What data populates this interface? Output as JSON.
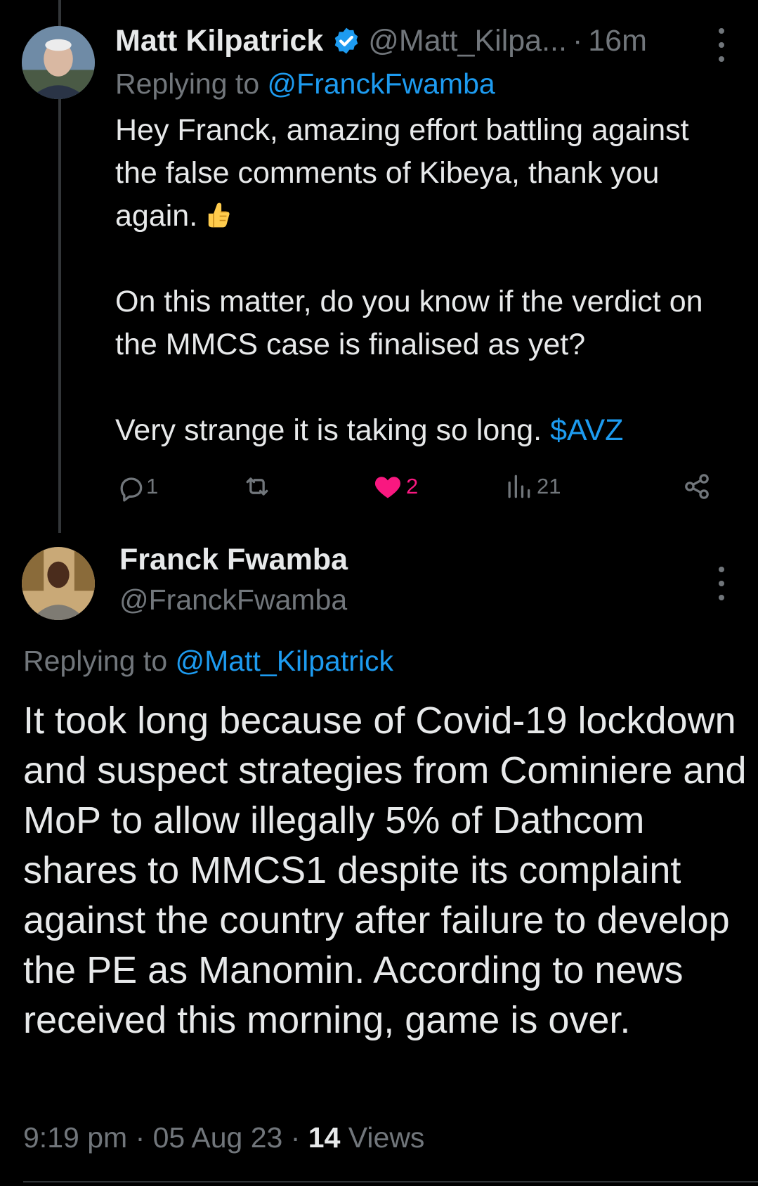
{
  "tweet1": {
    "author_name": "Matt Kilpatrick",
    "handle": "@Matt_Kilpa...",
    "separator": "·",
    "time_ago": "16m",
    "replying_prefix": "Replying to",
    "replying_to": "@FranckFwamba",
    "paragraph1": "Hey Franck, amazing effort battling against the false comments of Kibeya, thank you again.",
    "paragraph2": "On this matter, do you know if the verdict on the MMCS case is finalised as yet?",
    "paragraph3_text": "Very strange it is taking so long.",
    "paragraph3_cashtag": "$AVZ",
    "emoji": "thumbs-up",
    "stats": {
      "replies": "1",
      "likes": "2",
      "views": "21"
    }
  },
  "tweet2": {
    "author_name": "Franck Fwamba",
    "handle": "@FranckFwamba",
    "replying_prefix": "Replying to",
    "replying_to": "@Matt_Kilpatrick",
    "body": "It took long because of Covid-19 lockdown and suspect strategies from Cominiere and MoP to allow illegally 5% of Dathcom shares to MMCS1 despite its complaint against the country after failure to develop the PE as Manomin. According to news received this morning, game is over.",
    "time": "9:19 pm",
    "dot": "·",
    "date": "05 Aug 23",
    "views_count": "14",
    "views_label": "Views"
  },
  "colors": {
    "background": "#000000",
    "text": "#e7e9ea",
    "muted": "#71767b",
    "link": "#1d9bf0",
    "like": "#f91880",
    "verified": "#1d9bf0"
  }
}
